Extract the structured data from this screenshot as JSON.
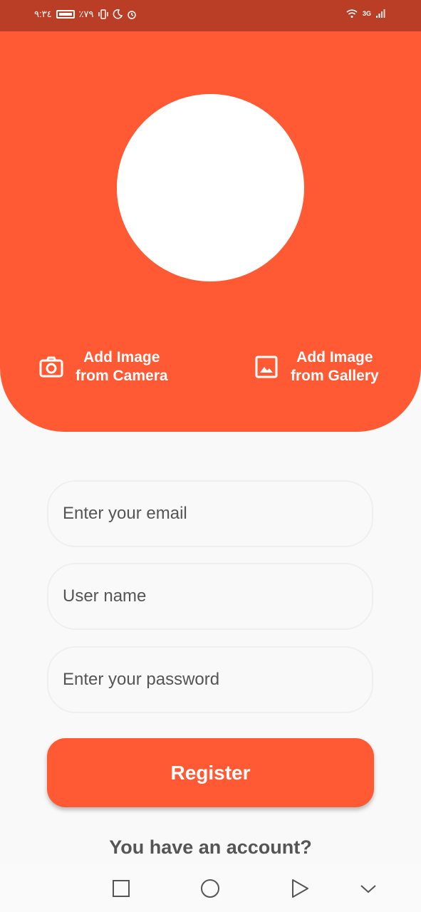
{
  "status_bar": {
    "time": "٩:٣٤",
    "battery": "٪٧٩",
    "network": "3G"
  },
  "header": {
    "camera_action": {
      "line1": "Add Image",
      "line2": "from Camera",
      "icon": "camera-icon"
    },
    "gallery_action": {
      "line1": "Add Image",
      "line2": "from Gallery",
      "icon": "image-icon"
    }
  },
  "form": {
    "email_placeholder": "Enter your email",
    "username_placeholder": "User name",
    "password_placeholder": "Enter your password",
    "register_label": "Register",
    "login_prompt": "You have an account?"
  },
  "colors": {
    "accent": "#FF5A34",
    "status_bar": "#B93E25",
    "background": "#F9F9F9"
  }
}
